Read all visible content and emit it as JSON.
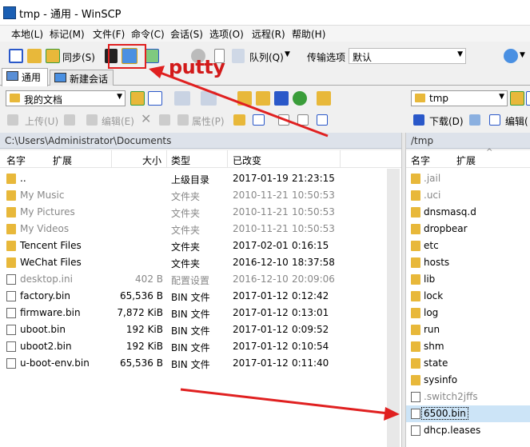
{
  "window": {
    "title": "tmp - 通用 - WinSCP"
  },
  "menu": [
    "本地(L)",
    "标记(M)",
    "文件(F)",
    "命令(C)",
    "会话(S)",
    "选项(O)",
    "远程(R)",
    "帮助(H)"
  ],
  "toolbar": {
    "sync_label": "同步(S)",
    "queue_label": "队列(Q)",
    "transfer_options_label": "传输选项",
    "transfer_preset": "默认"
  },
  "annotation": {
    "putty_text": "putty"
  },
  "tabs": {
    "general": "通用",
    "new_session": "新建会话"
  },
  "local": {
    "location": "我的文档",
    "path": "C:\\Users\\Administrator\\Documents",
    "actions": {
      "upload": "上传(U)",
      "edit": "编辑(E)",
      "properties": "属性(P)"
    },
    "columns": {
      "name": "名字",
      "ext": "扩展",
      "size": "大小",
      "type": "类型",
      "modified": "已改变"
    },
    "rows": [
      {
        "name": "..",
        "size": "",
        "type": "上级目录",
        "date": "2017-01-19",
        "time": "21:23:15",
        "icon": "up-dir-icon",
        "dim": false
      },
      {
        "name": "My Music",
        "size": "",
        "type": "文件夹",
        "date": "2010-11-21",
        "time": "10:50:53",
        "icon": "folder-icon",
        "dim": true
      },
      {
        "name": "My Pictures",
        "size": "",
        "type": "文件夹",
        "date": "2010-11-21",
        "time": "10:50:53",
        "icon": "folder-icon",
        "dim": true
      },
      {
        "name": "My Videos",
        "size": "",
        "type": "文件夹",
        "date": "2010-11-21",
        "time": "10:50:53",
        "icon": "folder-icon",
        "dim": true
      },
      {
        "name": "Tencent Files",
        "size": "",
        "type": "文件夹",
        "date": "2017-02-01",
        "time": "0:16:15",
        "icon": "folder-icon",
        "dim": false
      },
      {
        "name": "WeChat Files",
        "size": "",
        "type": "文件夹",
        "date": "2016-12-10",
        "time": "18:37:58",
        "icon": "folder-icon",
        "dim": false
      },
      {
        "name": "desktop.ini",
        "size": "402 B",
        "type": "配置设置",
        "date": "2016-12-10",
        "time": "20:09:06",
        "icon": "settings-file-icon",
        "dim": true
      },
      {
        "name": "factory.bin",
        "size": "65,536 B",
        "type": "BIN 文件",
        "date": "2017-01-12",
        "time": "0:12:42",
        "icon": "file-icon",
        "dim": false
      },
      {
        "name": "firmware.bin",
        "size": "7,872 KiB",
        "type": "BIN 文件",
        "date": "2017-01-12",
        "time": "0:13:01",
        "icon": "file-icon",
        "dim": false
      },
      {
        "name": "uboot.bin",
        "size": "192 KiB",
        "type": "BIN 文件",
        "date": "2017-01-12",
        "time": "0:09:52",
        "icon": "file-icon",
        "dim": false
      },
      {
        "name": "uboot2.bin",
        "size": "192 KiB",
        "type": "BIN 文件",
        "date": "2017-01-12",
        "time": "0:10:54",
        "icon": "file-icon",
        "dim": false
      },
      {
        "name": "u-boot-env.bin",
        "size": "65,536 B",
        "type": "BIN 文件",
        "date": "2017-01-12",
        "time": "0:11:40",
        "icon": "file-icon",
        "dim": false
      }
    ]
  },
  "remote": {
    "location": "tmp",
    "path": "/tmp",
    "actions": {
      "download": "下载(D)",
      "edit": "编辑("
    },
    "columns": {
      "name": "名字",
      "ext": "扩展"
    },
    "rows": [
      {
        "name": ".jail",
        "icon": "folder-icon",
        "dim": true,
        "selected": false
      },
      {
        "name": ".uci",
        "icon": "folder-icon",
        "dim": true,
        "selected": false
      },
      {
        "name": "dnsmasq.d",
        "icon": "folder-icon",
        "dim": false,
        "selected": false
      },
      {
        "name": "dropbear",
        "icon": "folder-icon",
        "dim": false,
        "selected": false
      },
      {
        "name": "etc",
        "icon": "folder-icon",
        "dim": false,
        "selected": false
      },
      {
        "name": "hosts",
        "icon": "folder-icon",
        "dim": false,
        "selected": false
      },
      {
        "name": "lib",
        "icon": "folder-icon",
        "dim": false,
        "selected": false
      },
      {
        "name": "lock",
        "icon": "folder-icon",
        "dim": false,
        "selected": false
      },
      {
        "name": "log",
        "icon": "folder-icon",
        "dim": false,
        "selected": false
      },
      {
        "name": "run",
        "icon": "folder-icon",
        "dim": false,
        "selected": false
      },
      {
        "name": "shm",
        "icon": "folder-icon",
        "dim": false,
        "selected": false
      },
      {
        "name": "state",
        "icon": "folder-icon",
        "dim": false,
        "selected": false
      },
      {
        "name": "sysinfo",
        "icon": "folder-icon",
        "dim": false,
        "selected": false
      },
      {
        "name": ".switch2jffs",
        "icon": "file-icon",
        "dim": true,
        "selected": false
      },
      {
        "name": "6500.bin",
        "icon": "file-icon",
        "dim": false,
        "selected": true
      },
      {
        "name": "dhcp.leases",
        "icon": "file-icon",
        "dim": false,
        "selected": false
      }
    ]
  },
  "colors": {
    "annotation_red": "#e02020",
    "folder_yellow": "#e8b83a",
    "selection": "#cce4f7"
  }
}
